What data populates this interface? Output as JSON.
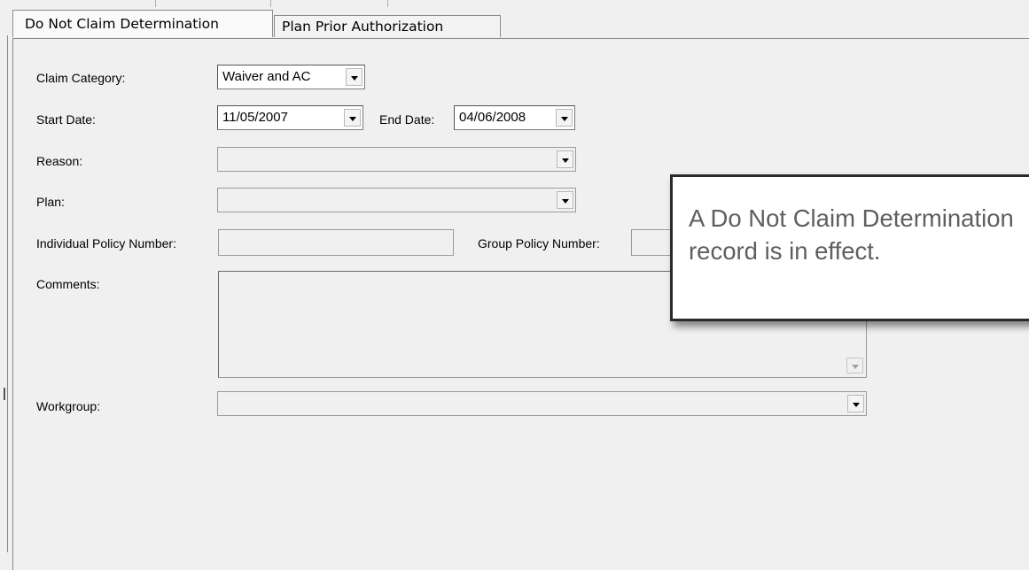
{
  "tabs": [
    {
      "label": "Do Not Claim Determination",
      "active": true
    },
    {
      "label": "Plan Prior Authorization",
      "active": false
    }
  ],
  "form": {
    "claim_category": {
      "label": "Claim Category:",
      "value": "Waiver and AC"
    },
    "start_date": {
      "label": "Start Date:",
      "value": "11/05/2007"
    },
    "end_date": {
      "label": "End Date:",
      "value": "04/06/2008"
    },
    "reason": {
      "label": "Reason:",
      "value": ""
    },
    "plan": {
      "label": "Plan:",
      "value": ""
    },
    "individual_policy_number": {
      "label": "Individual Policy Number:",
      "value": ""
    },
    "group_policy_number": {
      "label": "Group Policy Number:",
      "value": ""
    },
    "comments": {
      "label": "Comments:",
      "value": ""
    },
    "workgroup": {
      "label": "Workgroup:",
      "value": ""
    }
  },
  "callout": {
    "text": "A Do Not Claim Determination record is in effect."
  },
  "icons": {
    "dropdown": "chevron-down-icon",
    "scroll_down": "scroll-down-arrow-icon"
  }
}
